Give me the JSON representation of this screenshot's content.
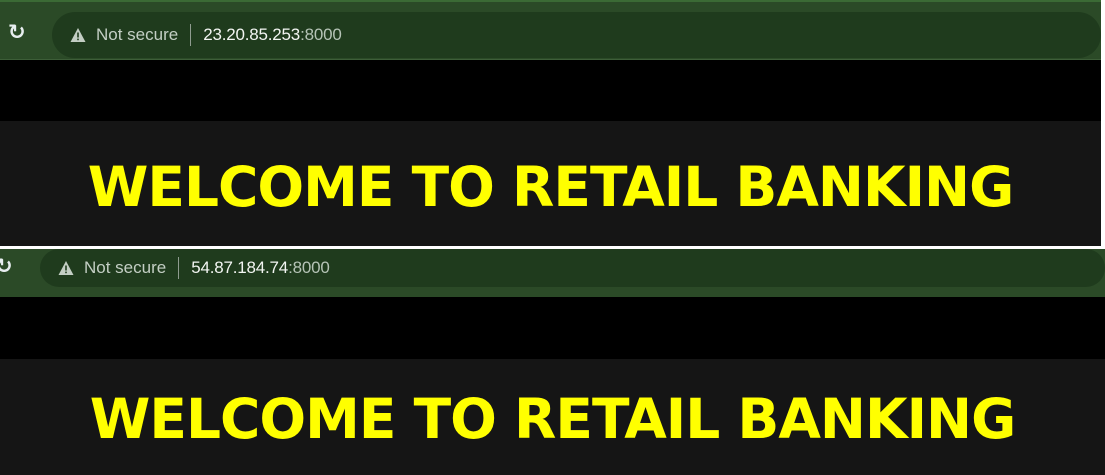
{
  "screens": [
    {
      "address_bar": {
        "security_label": "Not secure",
        "url_host": "23.20.85.253",
        "url_port": ":8000"
      },
      "page": {
        "heading": "WELCOME TO RETAIL BANKING"
      }
    },
    {
      "address_bar": {
        "security_label": "Not secure",
        "url_host": "54.87.184.74",
        "url_port": ":8000"
      },
      "page": {
        "heading": "WELCOME TO RETAIL BANKING"
      }
    }
  ],
  "icons": {
    "reload": "reload-icon",
    "security": "warning-triangle-icon"
  },
  "colors": {
    "toolbar_background": "#2b4a27",
    "omnibox_background": "#1f3b1d",
    "page_background": "#151515",
    "heading_text": "#ffff00"
  }
}
